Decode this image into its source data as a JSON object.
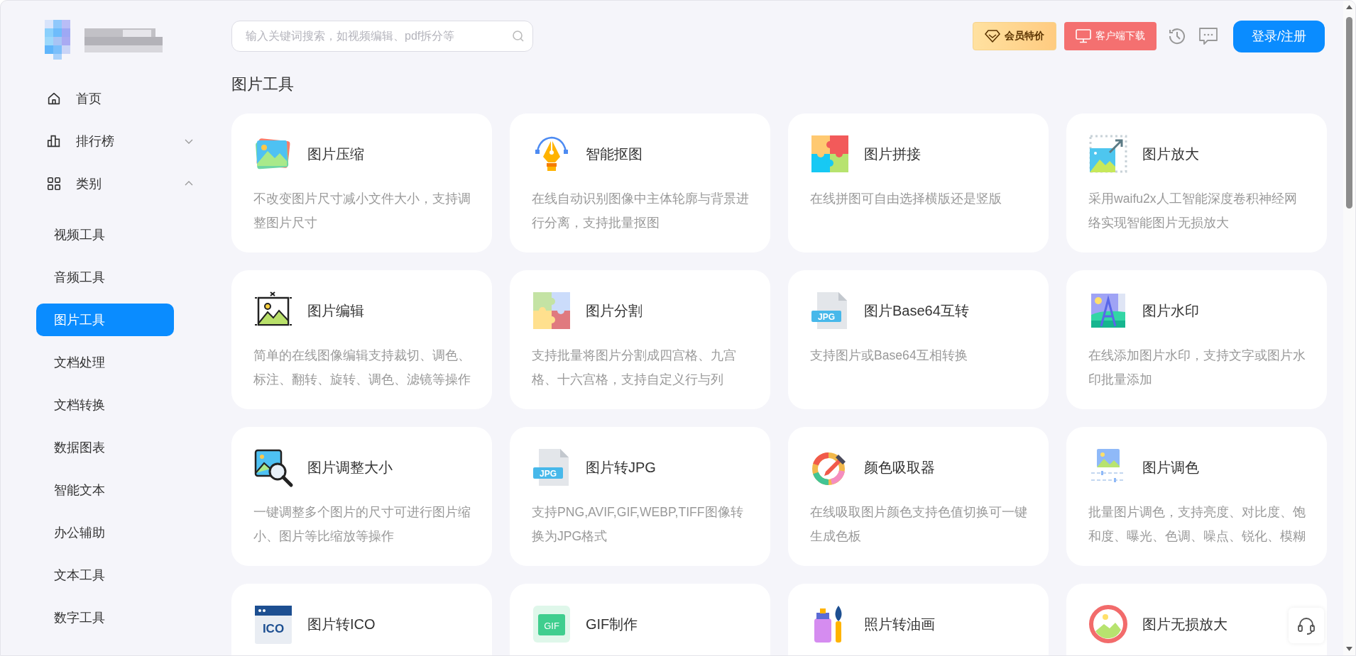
{
  "header": {
    "search": {
      "placeholder": "输入关键词搜索，如视频编辑、pdf拆分等"
    },
    "vip_button": "会员特价",
    "download_button": "客户端下载",
    "login_button": "登录/注册"
  },
  "sidebar": {
    "items": [
      {
        "label": "首页",
        "kind": "link"
      },
      {
        "label": "排行榜",
        "kind": "group",
        "expanded": false
      },
      {
        "label": "类别",
        "kind": "group",
        "expanded": true,
        "children": [
          {
            "label": "视频工具",
            "selected": false
          },
          {
            "label": "音频工具",
            "selected": false
          },
          {
            "label": "图片工具",
            "selected": true
          },
          {
            "label": "文档处理",
            "selected": false
          },
          {
            "label": "文档转换",
            "selected": false
          },
          {
            "label": "数据图表",
            "selected": false
          },
          {
            "label": "智能文本",
            "selected": false
          },
          {
            "label": "办公辅助",
            "selected": false
          },
          {
            "label": "文本工具",
            "selected": false
          },
          {
            "label": "数字工具",
            "selected": false
          }
        ]
      }
    ]
  },
  "section_title": "图片工具",
  "tools": [
    {
      "title": "图片压缩",
      "description": "不改变图片尺寸减小文件大小，支持调整图片尺寸"
    },
    {
      "title": "智能抠图",
      "description": "在线自动识别图像中主体轮廓与背景进行分离，支持批量抠图"
    },
    {
      "title": "图片拼接",
      "description": "在线拼图可自由选择横版还是竖版"
    },
    {
      "title": "图片放大",
      "description": "采用waifu2x人工智能深度卷积神经网络实现智能图片无损放大"
    },
    {
      "title": "图片编辑",
      "description": "简单的在线图像编辑支持裁切、调色、标注、翻转、旋转、调色、滤镜等操作"
    },
    {
      "title": "图片分割",
      "description": "支持批量将图片分割成四宫格、九宫格、十六宫格，支持自定义行与列"
    },
    {
      "title": "图片Base64互转",
      "description": "支持图片或Base64互相转换",
      "icon_text": "JPG"
    },
    {
      "title": "图片水印",
      "description": "在线添加图片水印，支持文字或图片水印批量添加"
    },
    {
      "title": "图片调整大小",
      "description": "一键调整多个图片的尺寸可进行图片缩小、图片等比缩放等操作"
    },
    {
      "title": "图片转JPG",
      "description": "支持PNG,AVIF,GIF,WEBP,TIFF图像转换为JPG格式",
      "icon_text": "JPG"
    },
    {
      "title": "颜色吸取器",
      "description": "在线吸取图片颜色支持色值切换可一键生成色板"
    },
    {
      "title": "图片调色",
      "description": "批量图片调色，支持亮度、对比度、饱和度、曝光、色调、噪点、锐化、模糊"
    },
    {
      "title": "图片转ICO",
      "icon_text": "ICO"
    },
    {
      "title": "GIF制作",
      "icon_text": "GIF"
    },
    {
      "title": "照片转油画"
    },
    {
      "title": "图片无损放大"
    }
  ]
}
